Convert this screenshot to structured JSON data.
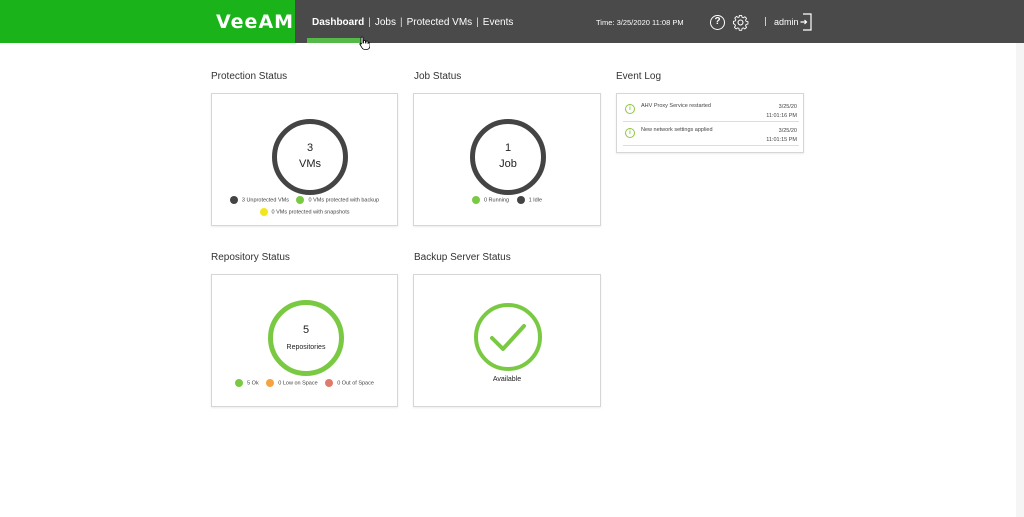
{
  "header": {
    "brand": "VeeAM",
    "nav": [
      {
        "label": "Dashboard",
        "active": true
      },
      {
        "label": "Jobs",
        "active": false
      },
      {
        "label": "Protected VMs",
        "active": false
      },
      {
        "label": "Events",
        "active": false
      }
    ],
    "time_label": "Time:",
    "time_value": "3/25/2020 11:08 PM",
    "help_symbol": "?",
    "user": "admin"
  },
  "protection": {
    "title": "Protection Status",
    "count": "3",
    "unit": "VMs",
    "legend": [
      {
        "label": "3 Unprotected VMs",
        "color": "#444444"
      },
      {
        "label": "0 VMs protected with backup",
        "color": "#7ac943"
      },
      {
        "label": "0 VMs protected with snapshots",
        "color": "#f4e61c"
      }
    ]
  },
  "job": {
    "title": "Job Status",
    "count": "1",
    "unit": "Job",
    "legend": [
      {
        "label": "0 Running",
        "color": "#7ac943"
      },
      {
        "label": "1 Idle",
        "color": "#444444"
      }
    ]
  },
  "repository": {
    "title": "Repository Status",
    "count": "5",
    "unit": "Repositories",
    "legend": [
      {
        "label": "5 Ok",
        "color": "#7ac943"
      },
      {
        "label": "0 Low on Space",
        "color": "#f5a340"
      },
      {
        "label": "0 Out of Space",
        "color": "#e07a6b"
      }
    ]
  },
  "backup_server": {
    "title": "Backup Server Status",
    "status": "Available"
  },
  "event_log": {
    "title": "Event Log",
    "events": [
      {
        "message": "AHV Proxy Service restarted",
        "date": "3/25/20",
        "time": "11:01:16 PM"
      },
      {
        "message": "New network settings applied",
        "date": "3/25/20",
        "time": "11:01:15 PM"
      }
    ]
  },
  "colors": {
    "brand_green": "#1ab31a",
    "header_dark": "#4a4a4a",
    "ring_dark": "#444444",
    "ring_green": "#7ac943"
  }
}
